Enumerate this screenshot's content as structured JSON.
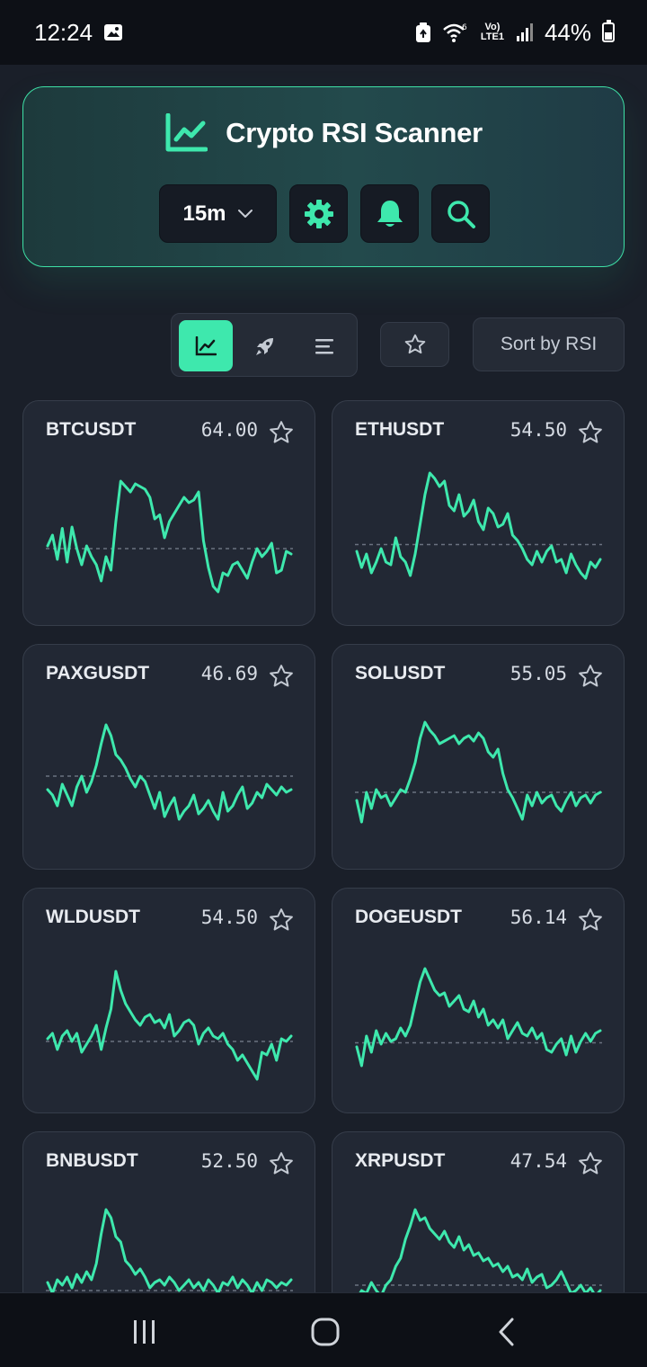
{
  "status_bar": {
    "time": "12:24",
    "network_label": "Vo) LTE1",
    "network_5g": "6",
    "battery": "44%",
    "icons": [
      "gallery-icon",
      "recycle-icon",
      "wifi-icon",
      "signal-icon",
      "battery-icon"
    ]
  },
  "header": {
    "title": "Crypto RSI Scanner",
    "timeframe": "15m",
    "icons": [
      "chart-line-icon",
      "chevron-down-icon",
      "gear-icon",
      "bell-icon",
      "search-icon"
    ]
  },
  "toolbar": {
    "view_modes": [
      "chart-view",
      "rocket-view",
      "list-view"
    ],
    "active_view": "chart-view",
    "sort_label": "Sort by RSI"
  },
  "colors": {
    "accent": "#3ee8ad",
    "background": "#1a1f29",
    "card": "#222834",
    "threshold_line": "#6b7280"
  },
  "cards": [
    {
      "symbol": "BTCUSDT",
      "rsi": "64.00"
    },
    {
      "symbol": "ETHUSDT",
      "rsi": "54.50"
    },
    {
      "symbol": "PAXGUSDT",
      "rsi": "46.69"
    },
    {
      "symbol": "SOLUSDT",
      "rsi": "55.05"
    },
    {
      "symbol": "WLDUSDT",
      "rsi": "54.50"
    },
    {
      "symbol": "DOGEUSDT",
      "rsi": "56.14"
    },
    {
      "symbol": "BNBUSDT",
      "rsi": "52.50"
    },
    {
      "symbol": "XRPUSDT",
      "rsi": "47.54"
    }
  ],
  "navbar": {
    "icons": [
      "recent-apps-icon",
      "home-icon",
      "back-icon"
    ]
  }
}
